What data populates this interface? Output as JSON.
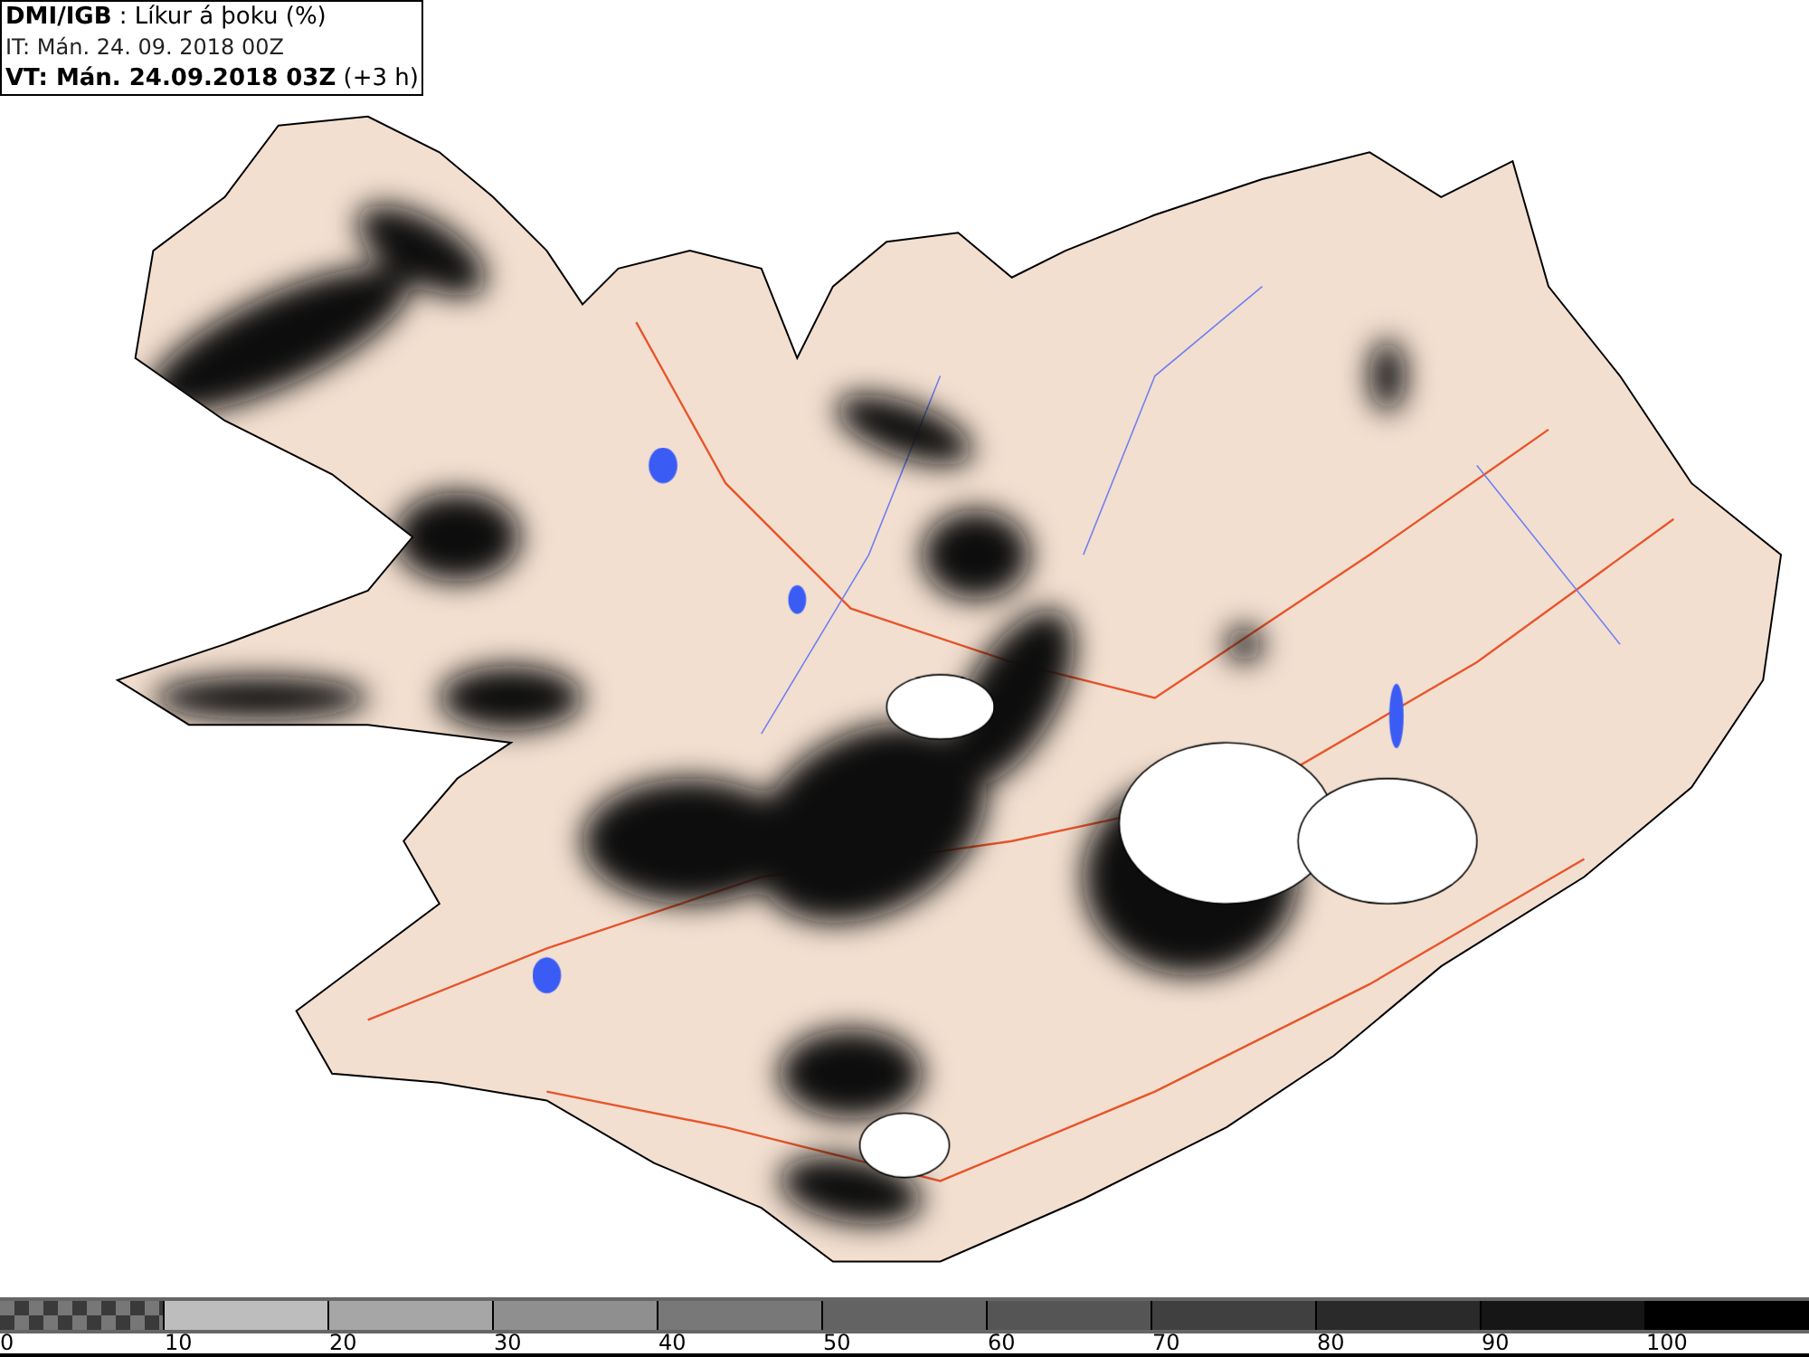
{
  "header": {
    "lines": [
      "**DMI/IGB** : Líkur á þoku (%)",
      "IT: Mán. 24. 09. 2018 00Z",
      "**VT: Mán. 24.09.2018 03Z** (+3 h)"
    ]
  },
  "legend": {
    "bins": [
      {
        "kind": "checker",
        "color": "#3a3a3a"
      },
      {
        "kind": "solid",
        "color": "#bdbdbd"
      },
      {
        "kind": "solid",
        "color": "#a6a6a6"
      },
      {
        "kind": "solid",
        "color": "#8f8f8f"
      },
      {
        "kind": "solid",
        "color": "#787878"
      },
      {
        "kind": "solid",
        "color": "#636363"
      },
      {
        "kind": "solid",
        "color": "#555555"
      },
      {
        "kind": "solid",
        "color": "#404040"
      },
      {
        "kind": "solid",
        "color": "#2a2a2a"
      },
      {
        "kind": "solid",
        "color": "#161616"
      },
      {
        "kind": "solid",
        "color": "#000000"
      }
    ],
    "ticks": [
      "0",
      "10",
      "20",
      "30",
      "40",
      "50",
      "60",
      "70",
      "80",
      "90",
      "100"
    ]
  }
}
